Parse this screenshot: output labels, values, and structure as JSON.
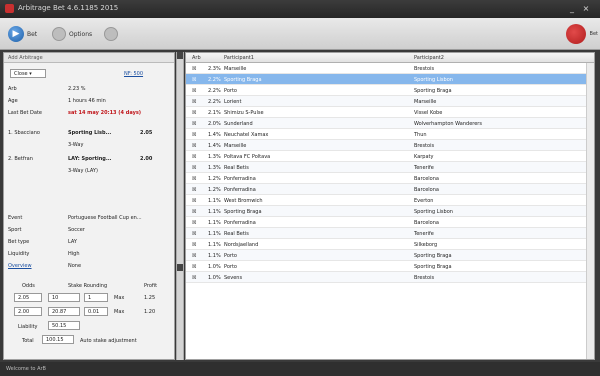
{
  "window": {
    "title": "Arbitrage Bet 4.6.1185 2015"
  },
  "toolbar": {
    "bet_label": "Bet",
    "options_label": "Options",
    "brand_label": "Bet"
  },
  "left": {
    "header": "Add Arbitrage",
    "combo_value": "Close",
    "nf_label": "NF: 500",
    "arb_label": "Arb",
    "arb_value": "2.23 %",
    "age_label": "Age",
    "age_value": "1 hours 46 min",
    "lastbet_label": "Last Bet Date",
    "lastbet_value": "sat 14 may 20:13 (4 days)",
    "bet1_label": "1. Sbacciano",
    "bet1_team": "Sporting Lisb...",
    "bet1_odds": "2.05",
    "bet1_sub": "3-Way",
    "bet2_label": "2. Betfran",
    "bet2_team": "LAY: Sporting...",
    "bet2_odds": "2.00",
    "bet2_sub": "3-Way (LAY)",
    "event_label": "Event",
    "event_value": "Portuguese Football Cup en...",
    "sport_label": "Sport",
    "sport_value": "Soccer",
    "bettype_label": "Bet type",
    "bettype_value": "LAY",
    "liquidity_label": "Liquidity",
    "liquidity_value": "High",
    "overview_label": "Overview",
    "overview_value": "None",
    "stake_head": [
      "Odds",
      "Stake Rounding",
      "Profit"
    ],
    "stake_rows": [
      {
        "odds": "2.05",
        "stake": "10",
        "round": "1",
        "max": "Max",
        "profit": "1.25"
      },
      {
        "odds": "2.00",
        "stake": "20.87",
        "round": "0.01",
        "max": "Max",
        "profit": "1.20"
      }
    ],
    "liability_label": "Liability",
    "liability_value": "50.15",
    "total_label": "Total",
    "total_value": "100.15",
    "auto_label": "Auto stake adjustment"
  },
  "grid": {
    "columns": [
      "Arb",
      "Participant1",
      "Participant2"
    ],
    "rows": [
      {
        "arb": "2.3%",
        "p1": "Marseille",
        "p2": "Brestois"
      },
      {
        "arb": "2.2%",
        "p1": "Sporting Braga",
        "p2": "Sporting Lisbon"
      },
      {
        "arb": "2.2%",
        "p1": "Porto",
        "p2": "Sporting Braga"
      },
      {
        "arb": "2.2%",
        "p1": "Lorient",
        "p2": "Marseille"
      },
      {
        "arb": "2.1%",
        "p1": "Shimizu S-Pulse",
        "p2": "Vissel Kobe"
      },
      {
        "arb": "2.0%",
        "p1": "Sunderland",
        "p2": "Wolverhampton Wanderers"
      },
      {
        "arb": "1.4%",
        "p1": "Neuchatel Xamax",
        "p2": "Thun"
      },
      {
        "arb": "1.4%",
        "p1": "Marseille",
        "p2": "Brestois"
      },
      {
        "arb": "1.3%",
        "p1": "Poltava FC Poltava",
        "p2": "Karpaty"
      },
      {
        "arb": "1.3%",
        "p1": "Real Betis",
        "p2": "Tenerife"
      },
      {
        "arb": "1.2%",
        "p1": "Ponferradina",
        "p2": "Barcelona"
      },
      {
        "arb": "1.2%",
        "p1": "Ponferradina",
        "p2": "Barcelona"
      },
      {
        "arb": "1.1%",
        "p1": "West Bromwich",
        "p2": "Everton"
      },
      {
        "arb": "1.1%",
        "p1": "Sporting Braga",
        "p2": "Sporting Lisbon"
      },
      {
        "arb": "1.1%",
        "p1": "Ponferradina",
        "p2": "Barcelona"
      },
      {
        "arb": "1.1%",
        "p1": "Real Betis",
        "p2": "Tenerife"
      },
      {
        "arb": "1.1%",
        "p1": "Nordsjaelland",
        "p2": "Silkeborg"
      },
      {
        "arb": "1.1%",
        "p1": "Porto",
        "p2": "Sporting Braga"
      },
      {
        "arb": "1.0%",
        "p1": "Porto",
        "p2": "Sporting Braga"
      },
      {
        "arb": "1.0%",
        "p1": "Sevens",
        "p2": "Brestois"
      }
    ],
    "selected_index": 1
  },
  "status": {
    "text": "Welcome to ArB"
  }
}
